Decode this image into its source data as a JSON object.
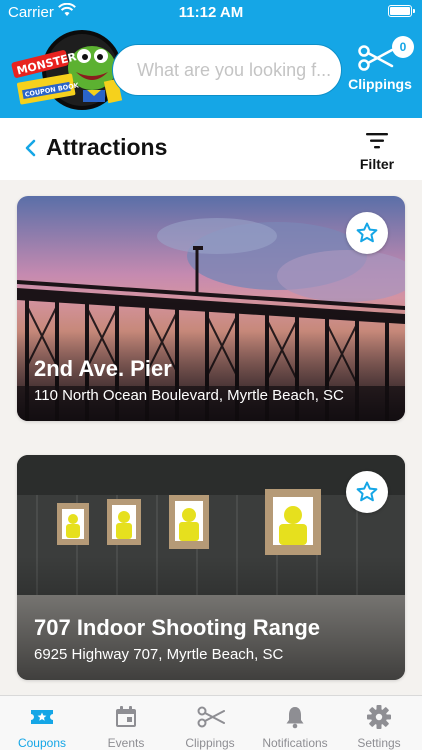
{
  "status": {
    "carrier": "Carrier",
    "time": "11:12 AM"
  },
  "logo": {
    "line1": "MONSTER",
    "line2": "COUPON BOOK"
  },
  "search": {
    "placeholder": "What are you looking f..."
  },
  "clippings_top": {
    "count": "0",
    "label": "Clippings"
  },
  "header": {
    "title": "Attractions",
    "filter_label": "Filter"
  },
  "cards": [
    {
      "name": "2nd Ave. Pier",
      "address": "110 North Ocean Boulevard, Myrtle Beach, SC"
    },
    {
      "name": "707 Indoor Shooting Range",
      "address": "6925 Highway 707, Myrtle Beach, SC"
    }
  ],
  "tabs": [
    {
      "label": "Coupons",
      "icon": "coupon-ticket-icon",
      "active": true
    },
    {
      "label": "Events",
      "icon": "calendar-icon",
      "active": false
    },
    {
      "label": "Clippings",
      "icon": "scissors-icon",
      "active": false
    },
    {
      "label": "Notifications",
      "icon": "bell-icon",
      "active": false
    },
    {
      "label": "Settings",
      "icon": "gear-icon",
      "active": false
    }
  ],
  "colors": {
    "brand": "#15a6e6",
    "tab_inactive": "#8e8e93"
  }
}
